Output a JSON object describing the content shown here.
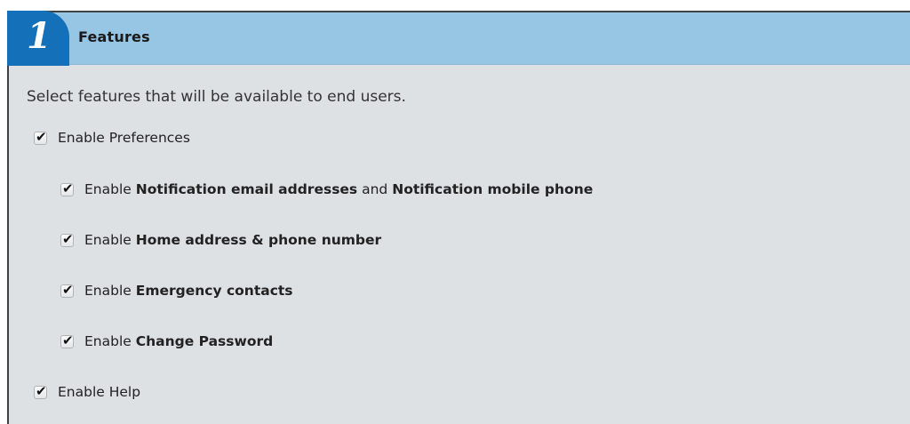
{
  "section": {
    "step_number": "1",
    "title": "Features",
    "intro": "Select features that will be available to end users."
  },
  "options": {
    "preferences": {
      "prefix": "Enable",
      "label": "Preferences",
      "checked": true
    },
    "notifications": {
      "prefix": "Enable",
      "label_a": "Notification email addresses",
      "joiner": "and",
      "label_b": "Notification mobile phone",
      "checked": true
    },
    "home_address": {
      "prefix": "Enable",
      "label": "Home address & phone number",
      "checked": true
    },
    "emergency": {
      "prefix": "Enable",
      "label": "Emergency contacts",
      "checked": true
    },
    "password": {
      "prefix": "Enable",
      "label": "Change Password",
      "checked": true
    },
    "help": {
      "prefix": "Enable",
      "label": "Help",
      "checked": true
    }
  },
  "icons": {
    "check": "checkmark-icon"
  },
  "colors": {
    "header_bar": "#97c5e4",
    "badge": "#1470b8",
    "panel_bg": "#dde1e4"
  }
}
